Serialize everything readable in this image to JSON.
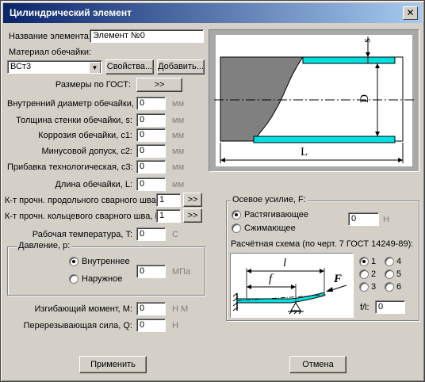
{
  "window": {
    "title": "Цилиндрический элемент",
    "close_glyph": "✕"
  },
  "element_name": {
    "label": "Название элемента:",
    "value": "Элемент №0"
  },
  "material": {
    "label": "Материал обечайки:",
    "value": "ВСт3",
    "properties_button": "Свойства...",
    "add_button": "Добавить..."
  },
  "gost_sizes": {
    "label": "Размеры по ГОСТ:",
    "button": ">>"
  },
  "fields": [
    {
      "label": "Внутренний диаметр обечайки, D:",
      "value": "0",
      "unit": "мм"
    },
    {
      "label": "Толщина стенки обечайки, s:",
      "value": "0",
      "unit": "мм"
    },
    {
      "label": "Коррозия обечайки, c1:",
      "value": "0",
      "unit": "мм"
    },
    {
      "label": "Минусовой допуск, c2:",
      "value": "0",
      "unit": "мм"
    },
    {
      "label": "Прибавка технологическая, c3:",
      "value": "0",
      "unit": "мм"
    },
    {
      "label": "Длина обечайки, L:",
      "value": "0",
      "unit": "мм"
    }
  ],
  "weld_long": {
    "label": "К-т прочн. продольного сварного шва, Fip:",
    "value": "1",
    "button": ">>"
  },
  "weld_circ": {
    "label": "К-т прочн. кольцевого сварного шва, Fic:",
    "value": "1",
    "button": ">>"
  },
  "temperature": {
    "label": "Рабочая температура, T:",
    "value": "0",
    "unit": "С"
  },
  "pressure": {
    "title": "Давление, p:",
    "internal": "Внутреннее",
    "external": "Наружное",
    "selected": "internal",
    "value": "0",
    "unit": "МПа"
  },
  "bending_moment": {
    "label": "Изгибающий момент, M:",
    "value": "0",
    "unit": "Н М"
  },
  "shear_force": {
    "label": "Перерезывающая сила, Q:",
    "value": "0",
    "unit": "Н"
  },
  "axial_force": {
    "title": "Осевое усилие, F:",
    "tension": "Растягивающее",
    "compression": "Сжимающее",
    "selected": "tension",
    "value": "0",
    "unit": "Н",
    "scheme_title": "Расчётная схема (по черт. 7   ГОСТ 14249-89):",
    "scheme_options": [
      "1",
      "2",
      "3",
      "4",
      "5",
      "6"
    ],
    "scheme_selected": "1",
    "fl_label": "f/l:",
    "fl_value": "0",
    "diagram_labels": {
      "l": "l",
      "f": "f",
      "F": "F"
    }
  },
  "shell_diagram_labels": {
    "s": "s",
    "D": "D",
    "L": "L"
  },
  "buttons": {
    "apply": "Применить",
    "cancel": "Отмена"
  },
  "colors": {
    "cyan": "#00e0e0",
    "dark_grey": "#808080",
    "title_blue": "#0a246a"
  }
}
